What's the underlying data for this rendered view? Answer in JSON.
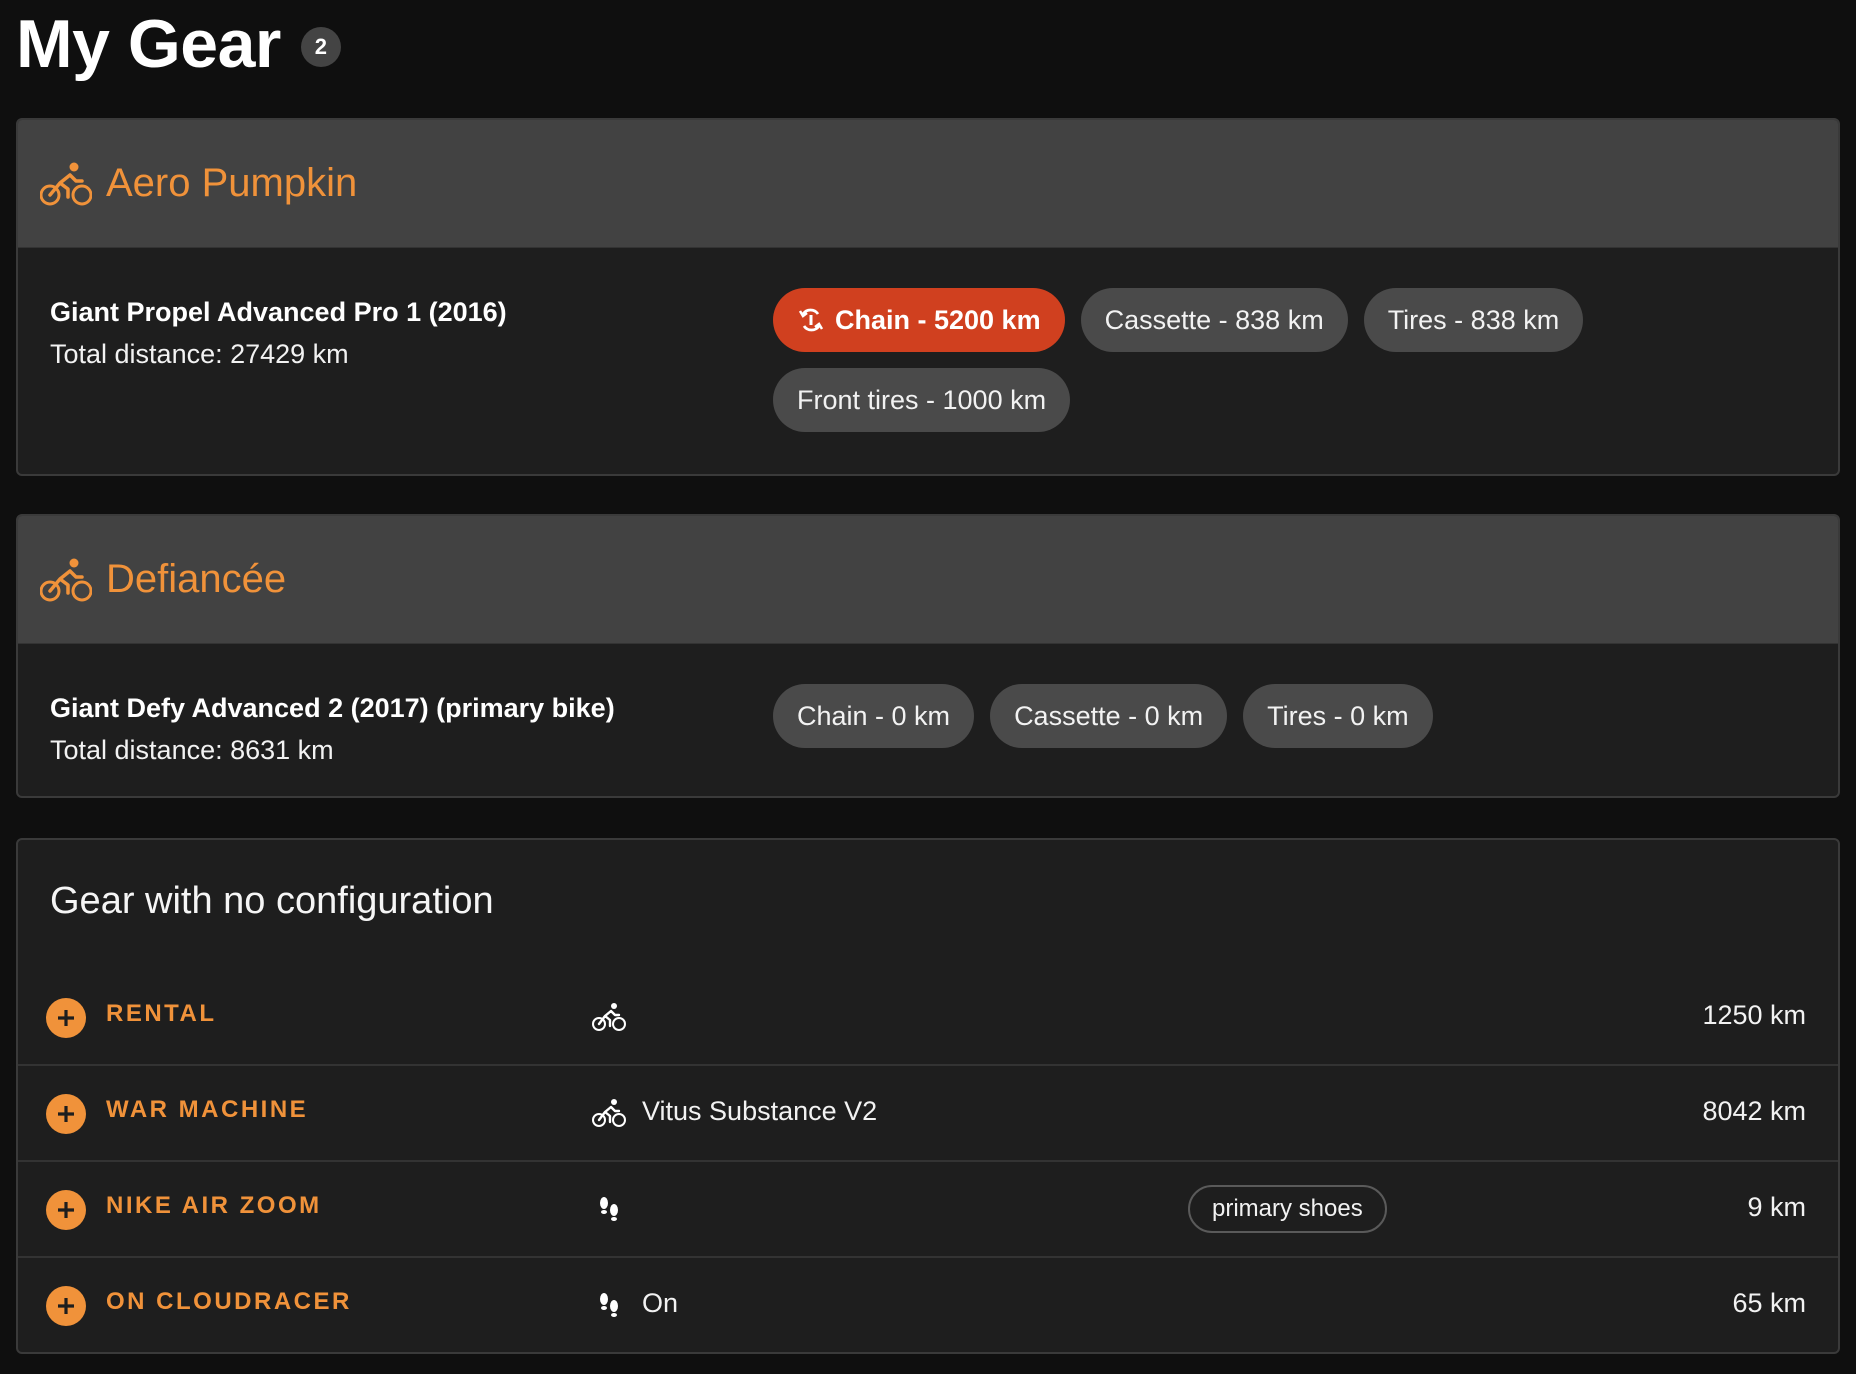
{
  "header": {
    "title": "My Gear",
    "count": "2"
  },
  "bikes": [
    {
      "name": "Aero Pumpkin",
      "model": "Giant Propel Advanced Pro 1 (2016)",
      "distance": "Total distance: 27429 km",
      "components": [
        {
          "label": "Chain - 5200 km",
          "alert": true
        },
        {
          "label": "Cassette - 838 km"
        },
        {
          "label": "Tires - 838 km"
        },
        {
          "label": "Front tires - 1000 km"
        }
      ]
    },
    {
      "name": "Defiancée",
      "model": "Giant Defy Advanced 2 (2017) (primary bike)",
      "distance": "Total distance: 8631 km",
      "components": [
        {
          "label": "Chain - 0 km"
        },
        {
          "label": "Cassette - 0 km"
        },
        {
          "label": "Tires - 0 km"
        }
      ]
    }
  ],
  "no_config": {
    "title": "Gear with no configuration",
    "items": [
      {
        "name": "RENTAL",
        "icon": "bike-icon",
        "model": "",
        "tag": "",
        "distance": "1250 km"
      },
      {
        "name": "WAR MACHINE",
        "icon": "bike-icon",
        "model": "Vitus Substance V2",
        "tag": "",
        "distance": "8042 km"
      },
      {
        "name": "NIKE AIR ZOOM",
        "icon": "footprints-icon",
        "model": "",
        "tag": "primary shoes",
        "distance": "9 km"
      },
      {
        "name": "ON CLOUDRACER",
        "icon": "footprints-icon",
        "model": "On",
        "tag": "",
        "distance": "65 km"
      }
    ]
  },
  "colors": {
    "accent": "#f0923a",
    "alert": "#d0401f",
    "card_header": "#424242",
    "card_body": "#1e1e1e",
    "page": "#0f0f0f"
  }
}
